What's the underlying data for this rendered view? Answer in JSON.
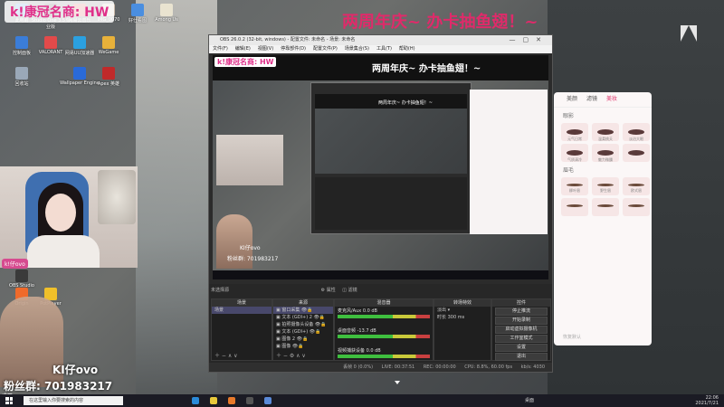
{
  "overlay": {
    "header_label": "k!康冠名商: HW",
    "title": "两周年庆~ 办卡抽鱼翅！~",
    "ovo_name": "KI仔ovo",
    "fans_group": "粉丝群: 701983217",
    "bang_prefix": "帮",
    "cam_tag": "k!仔ovo"
  },
  "desktop_icons": [
    {
      "label": "此电脑",
      "color": "#3b7dd8"
    },
    {
      "label": "Studio One 3.5专业版",
      "color": "#2a2a2a"
    },
    {
      "label": "网易云音乐",
      "color": "#d23a3a"
    },
    {
      "label": "IMG_0070",
      "color": "#c8b8a8"
    },
    {
      "label": "好仕看图",
      "color": "#4a8ee0"
    },
    {
      "label": "Among Us",
      "color": "#e9e3d0"
    },
    {
      "label": "控制面板",
      "color": "#3b7dd8"
    },
    {
      "label": "VALORANT",
      "color": "#e24a4a"
    },
    {
      "label": "网易UU加速器",
      "color": "#2ba0e0"
    },
    {
      "label": "WeGame",
      "color": "#e8b13a"
    },
    {
      "label": "回收站",
      "color": "#9aa8b8"
    },
    {
      "label": "OBS Studio",
      "color": "#3a3a3a"
    },
    {
      "label": "Origin",
      "color": "#f06a2a"
    },
    {
      "label": "PotPlayer",
      "color": "#f0c02a"
    },
    {
      "label": "Wallpaper Engine",
      "color": "#2a6ad8"
    },
    {
      "label": "Apex 英雄",
      "color": "#c02a2a"
    }
  ],
  "obs": {
    "window_title": "OBS 26.0.2 (32-bit, windows) - 配置文件: 未命名 - 场景: 未命名",
    "menu": [
      "文件(F)",
      "编辑(E)",
      "视图(V)",
      "停靠部件(D)",
      "配置文件(P)",
      "场景集合(S)",
      "工具(T)",
      "帮助(H)"
    ],
    "preview": {
      "header_label": "k!康冠名商: HW",
      "title": "两周年庆~ 办卡抽鱼翅！~",
      "inner_title": "两周年庆~ 办卡抽鱼翅！~",
      "ovo": "KI仔ovo",
      "fans": "粉丝群: 701983217"
    },
    "toolbar": {
      "source_label": "未选择源",
      "props": "属性",
      "filters": "滤镜"
    },
    "scenes": {
      "title": "场景",
      "items": [
        "场景"
      ]
    },
    "sources": {
      "title": "来源",
      "items": [
        "窗口采集",
        "文本 (GDI+) 2",
        "拍照摄像头设备",
        "文本 (GDI+)",
        "图像 2",
        "图像"
      ]
    },
    "mixer": {
      "title": "混音器",
      "channels": [
        {
          "name": "麦克风/Aux",
          "db": "0.0 dB"
        },
        {
          "name": "桌面音频",
          "db": "-13.7 dB"
        },
        {
          "name": "视频捕获设备",
          "db": "0.0 dB"
        }
      ]
    },
    "transitions": {
      "title": "转场特效",
      "type": "淡出",
      "duration_label": "时长",
      "duration": "300 ms"
    },
    "controls": {
      "title": "控件",
      "buttons": [
        "停止推流",
        "开始录制",
        "启动虚拟摄像机",
        "工作室模式",
        "设置",
        "退出"
      ]
    },
    "status": {
      "dropped": "丢帧 0 (0.0%)",
      "live": "LIVE: 00:37:51",
      "rec": "REC: 00:00:00",
      "cpu": "CPU: 8.8%, 60.00 fps",
      "kbps": "kb/s: 4030"
    }
  },
  "beauty_panel": {
    "tabs": [
      "美颜",
      "滤镜",
      "美妆"
    ],
    "active_tab": "美妆",
    "section_1": "眼影",
    "section_1_items": [
      "元气日常",
      "温柔桃夭",
      "淡泊大眼",
      "气质清冷",
      "魅力微醺",
      ""
    ],
    "section_2": "眉毛",
    "section_2_items": [
      "柳叶眉",
      "野生眉",
      "欧式眉",
      "",
      "",
      ""
    ],
    "footer": "恢复默认"
  },
  "taskbar": {
    "search_placeholder": "在这里输入你要搜索的内容",
    "desktop_label": "桌面",
    "time": "22:06",
    "date": "2021/7/21"
  }
}
